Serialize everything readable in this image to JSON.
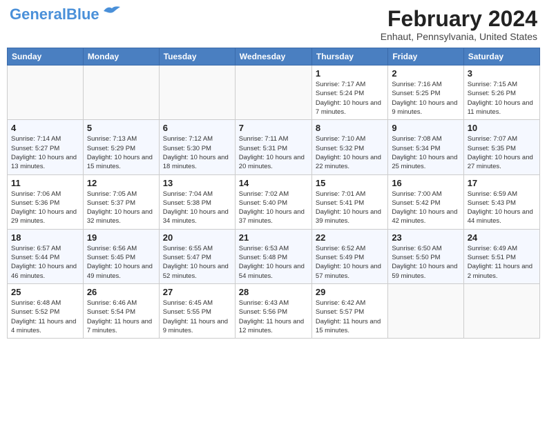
{
  "header": {
    "logo_line1": "General",
    "logo_line2": "Blue",
    "main_title": "February 2024",
    "subtitle": "Enhaut, Pennsylvania, United States"
  },
  "weekdays": [
    "Sunday",
    "Monday",
    "Tuesday",
    "Wednesday",
    "Thursday",
    "Friday",
    "Saturday"
  ],
  "weeks": [
    [
      {
        "day": "",
        "info": ""
      },
      {
        "day": "",
        "info": ""
      },
      {
        "day": "",
        "info": ""
      },
      {
        "day": "",
        "info": ""
      },
      {
        "day": "1",
        "info": "Sunrise: 7:17 AM\nSunset: 5:24 PM\nDaylight: 10 hours\nand 7 minutes."
      },
      {
        "day": "2",
        "info": "Sunrise: 7:16 AM\nSunset: 5:25 PM\nDaylight: 10 hours\nand 9 minutes."
      },
      {
        "day": "3",
        "info": "Sunrise: 7:15 AM\nSunset: 5:26 PM\nDaylight: 10 hours\nand 11 minutes."
      }
    ],
    [
      {
        "day": "4",
        "info": "Sunrise: 7:14 AM\nSunset: 5:27 PM\nDaylight: 10 hours\nand 13 minutes."
      },
      {
        "day": "5",
        "info": "Sunrise: 7:13 AM\nSunset: 5:29 PM\nDaylight: 10 hours\nand 15 minutes."
      },
      {
        "day": "6",
        "info": "Sunrise: 7:12 AM\nSunset: 5:30 PM\nDaylight: 10 hours\nand 18 minutes."
      },
      {
        "day": "7",
        "info": "Sunrise: 7:11 AM\nSunset: 5:31 PM\nDaylight: 10 hours\nand 20 minutes."
      },
      {
        "day": "8",
        "info": "Sunrise: 7:10 AM\nSunset: 5:32 PM\nDaylight: 10 hours\nand 22 minutes."
      },
      {
        "day": "9",
        "info": "Sunrise: 7:08 AM\nSunset: 5:34 PM\nDaylight: 10 hours\nand 25 minutes."
      },
      {
        "day": "10",
        "info": "Sunrise: 7:07 AM\nSunset: 5:35 PM\nDaylight: 10 hours\nand 27 minutes."
      }
    ],
    [
      {
        "day": "11",
        "info": "Sunrise: 7:06 AM\nSunset: 5:36 PM\nDaylight: 10 hours\nand 29 minutes."
      },
      {
        "day": "12",
        "info": "Sunrise: 7:05 AM\nSunset: 5:37 PM\nDaylight: 10 hours\nand 32 minutes."
      },
      {
        "day": "13",
        "info": "Sunrise: 7:04 AM\nSunset: 5:38 PM\nDaylight: 10 hours\nand 34 minutes."
      },
      {
        "day": "14",
        "info": "Sunrise: 7:02 AM\nSunset: 5:40 PM\nDaylight: 10 hours\nand 37 minutes."
      },
      {
        "day": "15",
        "info": "Sunrise: 7:01 AM\nSunset: 5:41 PM\nDaylight: 10 hours\nand 39 minutes."
      },
      {
        "day": "16",
        "info": "Sunrise: 7:00 AM\nSunset: 5:42 PM\nDaylight: 10 hours\nand 42 minutes."
      },
      {
        "day": "17",
        "info": "Sunrise: 6:59 AM\nSunset: 5:43 PM\nDaylight: 10 hours\nand 44 minutes."
      }
    ],
    [
      {
        "day": "18",
        "info": "Sunrise: 6:57 AM\nSunset: 5:44 PM\nDaylight: 10 hours\nand 46 minutes."
      },
      {
        "day": "19",
        "info": "Sunrise: 6:56 AM\nSunset: 5:45 PM\nDaylight: 10 hours\nand 49 minutes."
      },
      {
        "day": "20",
        "info": "Sunrise: 6:55 AM\nSunset: 5:47 PM\nDaylight: 10 hours\nand 52 minutes."
      },
      {
        "day": "21",
        "info": "Sunrise: 6:53 AM\nSunset: 5:48 PM\nDaylight: 10 hours\nand 54 minutes."
      },
      {
        "day": "22",
        "info": "Sunrise: 6:52 AM\nSunset: 5:49 PM\nDaylight: 10 hours\nand 57 minutes."
      },
      {
        "day": "23",
        "info": "Sunrise: 6:50 AM\nSunset: 5:50 PM\nDaylight: 10 hours\nand 59 minutes."
      },
      {
        "day": "24",
        "info": "Sunrise: 6:49 AM\nSunset: 5:51 PM\nDaylight: 11 hours\nand 2 minutes."
      }
    ],
    [
      {
        "day": "25",
        "info": "Sunrise: 6:48 AM\nSunset: 5:52 PM\nDaylight: 11 hours\nand 4 minutes."
      },
      {
        "day": "26",
        "info": "Sunrise: 6:46 AM\nSunset: 5:54 PM\nDaylight: 11 hours\nand 7 minutes."
      },
      {
        "day": "27",
        "info": "Sunrise: 6:45 AM\nSunset: 5:55 PM\nDaylight: 11 hours\nand 9 minutes."
      },
      {
        "day": "28",
        "info": "Sunrise: 6:43 AM\nSunset: 5:56 PM\nDaylight: 11 hours\nand 12 minutes."
      },
      {
        "day": "29",
        "info": "Sunrise: 6:42 AM\nSunset: 5:57 PM\nDaylight: 11 hours\nand 15 minutes."
      },
      {
        "day": "",
        "info": ""
      },
      {
        "day": "",
        "info": ""
      }
    ]
  ]
}
